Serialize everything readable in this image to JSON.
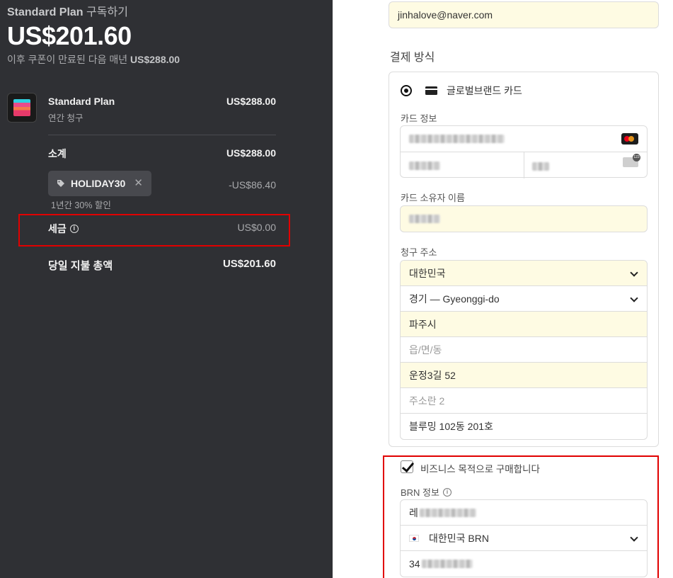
{
  "summary": {
    "plan_name": "Standard Plan",
    "subscribe_suffix": "구독하기",
    "price": "US$201.60",
    "after_coupon_note": "이후 쿠폰이 만료된 다음 매년",
    "after_coupon_price": "US$288.00",
    "item": {
      "name": "Standard Plan",
      "billing": "연간 청구",
      "price": "US$288.00"
    },
    "subtotal_label": "소계",
    "subtotal_value": "US$288.00",
    "coupon": {
      "code": "HOLIDAY30",
      "discount": "-US$86.40",
      "note": "1년간 30% 할인"
    },
    "tax_label": "세금",
    "tax_value": "US$0.00",
    "total_label": "당일 지불 총액",
    "total_value": "US$201.60"
  },
  "form": {
    "email": "jinhalove@naver.com",
    "payment_method_title": "결제 방식",
    "card_type": "글로벌브랜드 카드",
    "card_info_label": "카드 정보",
    "card_holder_label": "카드 소유자 이름",
    "billing_address_label": "청구 주소",
    "address": {
      "country": "대한민국",
      "province": "경기 — Gyeonggi-do",
      "city": "파주시",
      "district_placeholder": "읍/면/동",
      "line1": "운정3길 52",
      "line2_placeholder": "주소란 2",
      "line3": "블루밍 102동 201호"
    },
    "business_checkbox_label": "비즈니스 목적으로 구매합니다",
    "business_checked": true,
    "brn_label": "BRN 정보",
    "brn_name_prefix": "레",
    "brn_type": "대한민국 BRN",
    "brn_number_prefix": "34"
  },
  "colors": {
    "left_bg": "#2f3034",
    "highlight_border": "#e10000",
    "autofill_bg": "#fefbe3"
  }
}
